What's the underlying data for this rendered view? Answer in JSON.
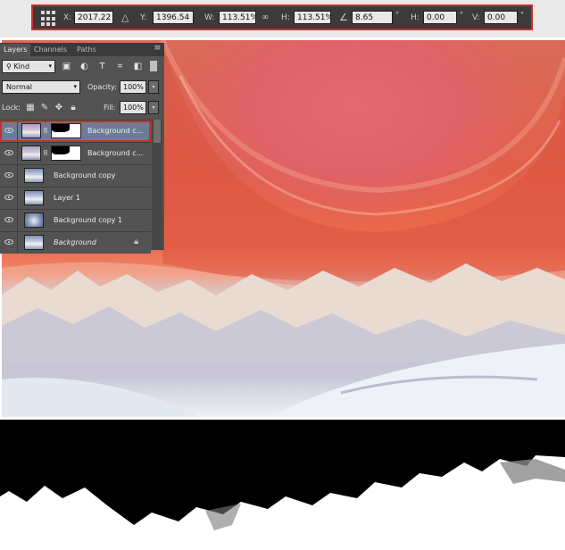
{
  "options_bar": {
    "x_label": "X:",
    "x_value": "2017.22 p",
    "y_label": "Y:",
    "y_value": "1396.54 p",
    "w_label": "W:",
    "w_value": "113.51%",
    "h_label": "H:",
    "h_value": "113.51%",
    "rotate_value": "8.65",
    "skew_h_label": "H:",
    "skew_h_value": "0.00",
    "skew_v_label": "V:",
    "skew_v_value": "0.00",
    "degree_symbol": "°",
    "accent_color": "#c8302d"
  },
  "layers_panel": {
    "tabs": [
      {
        "label": "Layers",
        "active": true
      },
      {
        "label": "Channels",
        "active": false
      },
      {
        "label": "Paths",
        "active": false
      }
    ],
    "kind_filter": "Kind",
    "blend_mode": "Normal",
    "opacity_label": "Opacity:",
    "opacity_value": "100%",
    "lock_label": "Lock:",
    "fill_label": "Fill:",
    "fill_value": "100%",
    "layers": [
      {
        "name": "Background c...",
        "has_mask": true,
        "selected": true
      },
      {
        "name": "Background c...",
        "has_mask": true,
        "selected": false
      },
      {
        "name": "Background copy",
        "has_mask": false,
        "selected": false
      },
      {
        "name": "Layer 1",
        "has_mask": false,
        "selected": false
      },
      {
        "name": "Background copy 1",
        "has_mask": false,
        "selected": false
      },
      {
        "name": "Background",
        "has_mask": false,
        "selected": false,
        "locked": true,
        "italic": true
      }
    ]
  },
  "icons": [
    "reference-point-icon",
    "delta-icon",
    "link-icon",
    "rotate-angle-icon",
    "eye-icon",
    "chain-link-icon",
    "lock-icon",
    "panel-menu-icon"
  ]
}
